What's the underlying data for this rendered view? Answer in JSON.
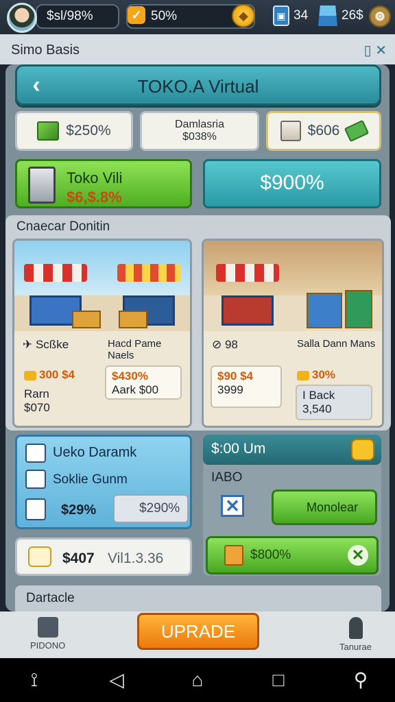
{
  "hud": {
    "player_cash": "$sl/98%",
    "coin_value": "50%",
    "resource_a": "34",
    "resource_b": "26$"
  },
  "subbar": {
    "title": "Simo Basis"
  },
  "header": {
    "title": "TOKO.A Virtual"
  },
  "stats": {
    "cube_value": "$250%",
    "center_line1": "Damlasria",
    "center_line2": "$038%",
    "box_value": "$606"
  },
  "actions": {
    "toko_title": "Toko Vili",
    "toko_price": "$6,$.8%",
    "teal_value": "$900%"
  },
  "shop": {
    "header": "Cnaecar Donitin",
    "cards": [
      {
        "left_name": "Scßke",
        "right_name": "Hacd Pame Naels",
        "tag1": "300 $4",
        "tag2": "$430%",
        "item1_name": "Rarn",
        "item1_price": "$070",
        "item2_name": "Aark",
        "item2_price": "$00"
      },
      {
        "left_name": "98",
        "right_name": "Salla Dann Mans",
        "tag1": "$90 $4",
        "tag2": "30%",
        "item1_name": "",
        "item1_price": "3999",
        "item2_name": "I Back",
        "item2_price": "3,540"
      }
    ]
  },
  "bottom_left": {
    "title": "Ueko Daramk",
    "subtitle": "Soklie Gunm",
    "price": "$29%",
    "button": "$290%"
  },
  "wide_row": {
    "value_a": "$407",
    "value_b": "Vil1.3.36"
  },
  "bottom_right": {
    "header": "$:00 Um",
    "label": "IABO",
    "button_green": "Monolear",
    "button_wide": "$800%"
  },
  "detail": {
    "title": "Dartacle"
  },
  "bottom_bar": {
    "left_label": "PIDONO",
    "upgrade": "UPRADE",
    "right_label": "Tanurae"
  },
  "colors": {
    "accent_teal": "#2b8c9a",
    "accent_green": "#4fae21",
    "accent_orange": "#ec7a0c"
  }
}
